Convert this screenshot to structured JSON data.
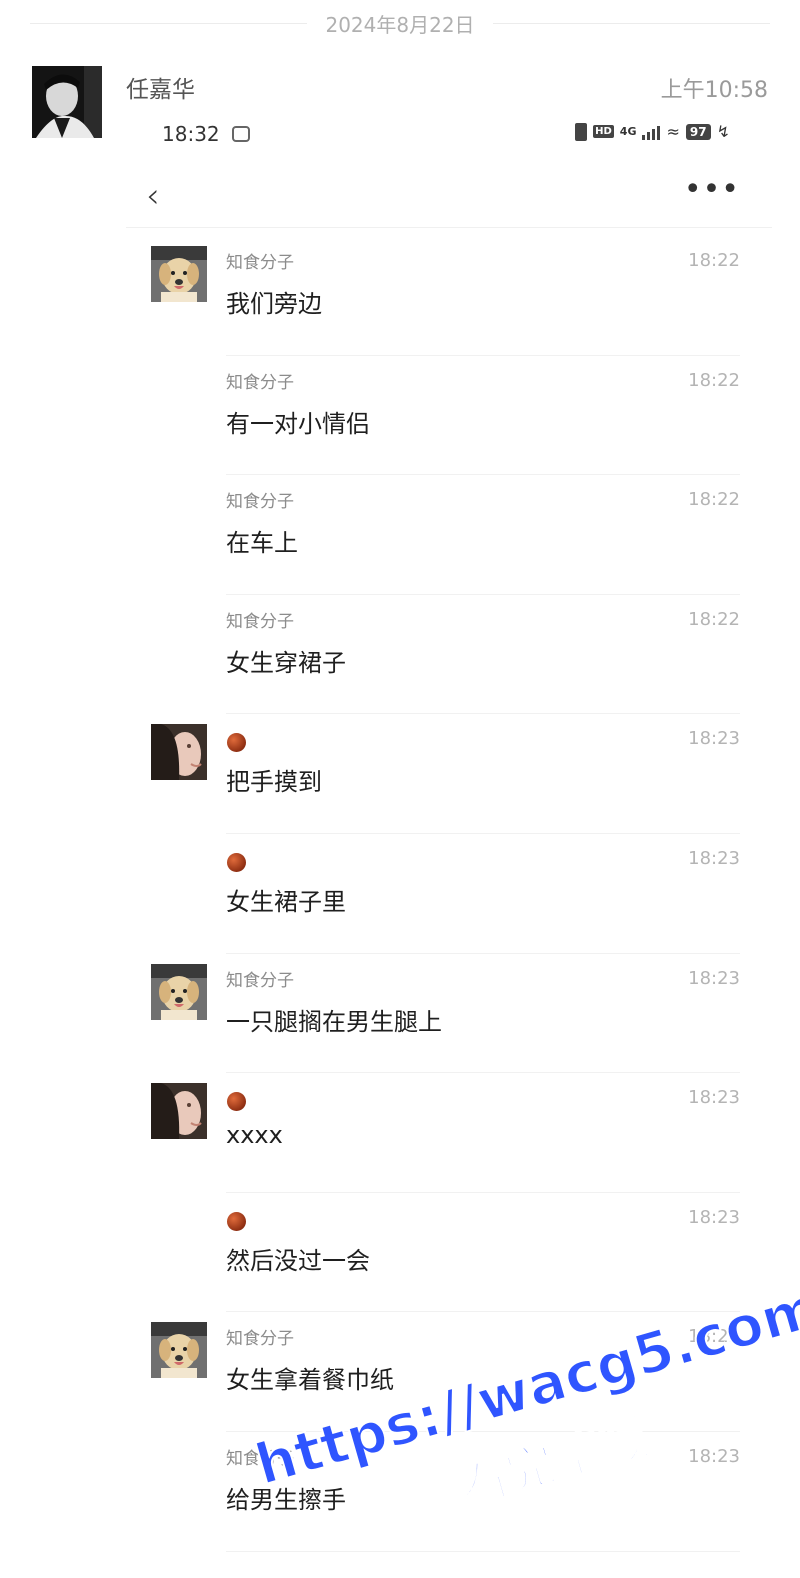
{
  "date_divider": "2024年8月22日",
  "sender": {
    "name": "任嘉华",
    "time": "上午10:58"
  },
  "status_bar": {
    "time": "18:32",
    "network": "4G",
    "battery": "97"
  },
  "nav": {
    "back_icon": "chevron-left-icon",
    "more_label": "•••"
  },
  "messages": [
    {
      "name": "知食分子",
      "time": "18:22",
      "text": "我们旁边",
      "avatar": "dog",
      "show_avatar": true
    },
    {
      "name": "知食分子",
      "time": "18:22",
      "text": "有一对小情侣",
      "avatar": "dog",
      "show_avatar": false
    },
    {
      "name": "知食分子",
      "time": "18:22",
      "text": "在车上",
      "avatar": "dog",
      "show_avatar": false
    },
    {
      "name": "知食分子",
      "time": "18:22",
      "text": "女生穿裙子",
      "avatar": "dog",
      "show_avatar": false
    },
    {
      "name": "",
      "time": "18:23",
      "text": "把手摸到",
      "avatar": "girl",
      "show_avatar": true
    },
    {
      "name": "",
      "time": "18:23",
      "text": "女生裙子里",
      "avatar": "girl",
      "show_avatar": false
    },
    {
      "name": "知食分子",
      "time": "18:23",
      "text": "一只腿搁在男生腿上",
      "avatar": "dog",
      "show_avatar": true
    },
    {
      "name": "",
      "time": "18:23",
      "text": "xxxx",
      "avatar": "girl",
      "show_avatar": true
    },
    {
      "name": "",
      "time": "18:23",
      "text": "然后没过一会",
      "avatar": "girl",
      "show_avatar": false
    },
    {
      "name": "知食分子",
      "time": "18:23",
      "text": "女生拿着餐巾纸",
      "avatar": "dog",
      "show_avatar": true
    },
    {
      "name": "知食分子",
      "time": "18:23",
      "text": "给男生擦手",
      "avatar": "dog",
      "show_avatar": false
    }
  ],
  "watermark": {
    "url": "https://wacg5.com",
    "subtitle": "看完整版"
  },
  "colors": {
    "watermark": "#2f55ff",
    "time": "#b4b4b4",
    "name": "#8c8c8c"
  }
}
